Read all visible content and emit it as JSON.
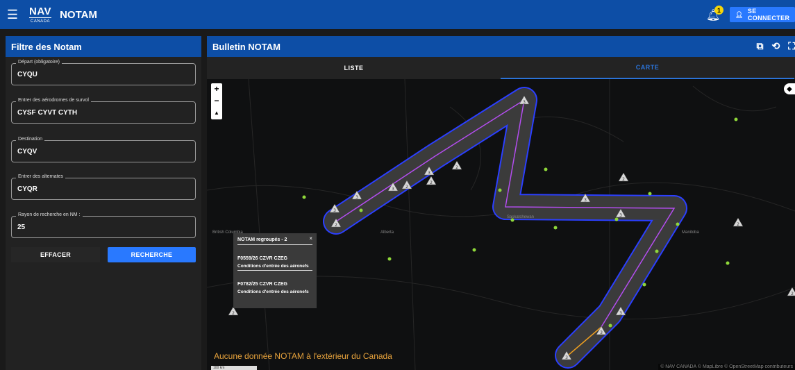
{
  "topbar": {
    "logo_top": "NAV",
    "logo_bottom": "CANADA",
    "app_title": "NOTAM",
    "notification_count": "1",
    "login_label": "SE CONNECTER",
    "icons": {
      "menu": "hamburger-icon",
      "bell": "bell-icon",
      "user": "user-icon"
    }
  },
  "filter": {
    "title": "Filtre des Notam",
    "fields": [
      {
        "label": "Départ (obligatoire)",
        "value": "CYQU"
      },
      {
        "label": "Entrer des aérodromes de survol",
        "value": "CYSF CYVT CYTH"
      },
      {
        "label": "Destination",
        "value": "CYQV"
      },
      {
        "label": "Entrer des alternates",
        "value": "CYQR"
      },
      {
        "label": "Rayon de recherche en NM :",
        "value": "25"
      }
    ],
    "clear_label": "EFFACER",
    "search_label": "RECHERCHE"
  },
  "bulletin": {
    "title": "Bulletin NOTAM",
    "tabs": [
      {
        "label": "LISTE",
        "active": false
      },
      {
        "label": "CARTE",
        "active": true
      }
    ],
    "icons": [
      "add-window-icon",
      "history-icon",
      "fullscreen-icon"
    ]
  },
  "map": {
    "zoom_in": "+",
    "zoom_out": "−",
    "compass": "▲",
    "region_labels": [
      "British Columbia",
      "Alberta",
      "Saskatchewan",
      "Manitoba"
    ],
    "no_data_message": "Aucune donnée NOTAM à l'extérieur du Canada",
    "attribution": "© NAV CANADA © MapLibre © OpenStreetMap contributeurs",
    "scale": "100 km",
    "colors": {
      "route_buffer": "#3b3b3b",
      "buffer_outline": "#2b3fff",
      "route_line": "#b44df0",
      "alt_route": "#f0a020",
      "airport_dot": "#8fd83a"
    },
    "popup": {
      "title": "NOTAM regroupés - 2",
      "items": [
        {
          "id": "F0559/26 CZVR CZEG",
          "desc": "Conditions d'entrée des aéronefs"
        },
        {
          "id": "F0782/25 CZVR CZEG",
          "desc": "Conditions d'entrée des aéronefs"
        }
      ]
    },
    "markers": [
      "3",
      "2",
      "3",
      "2",
      "2",
      "3",
      "3",
      "3",
      "2",
      "2",
      "3",
      "3",
      "2",
      "3",
      "3",
      "3",
      "2",
      "2",
      "2",
      "4",
      "5"
    ]
  }
}
